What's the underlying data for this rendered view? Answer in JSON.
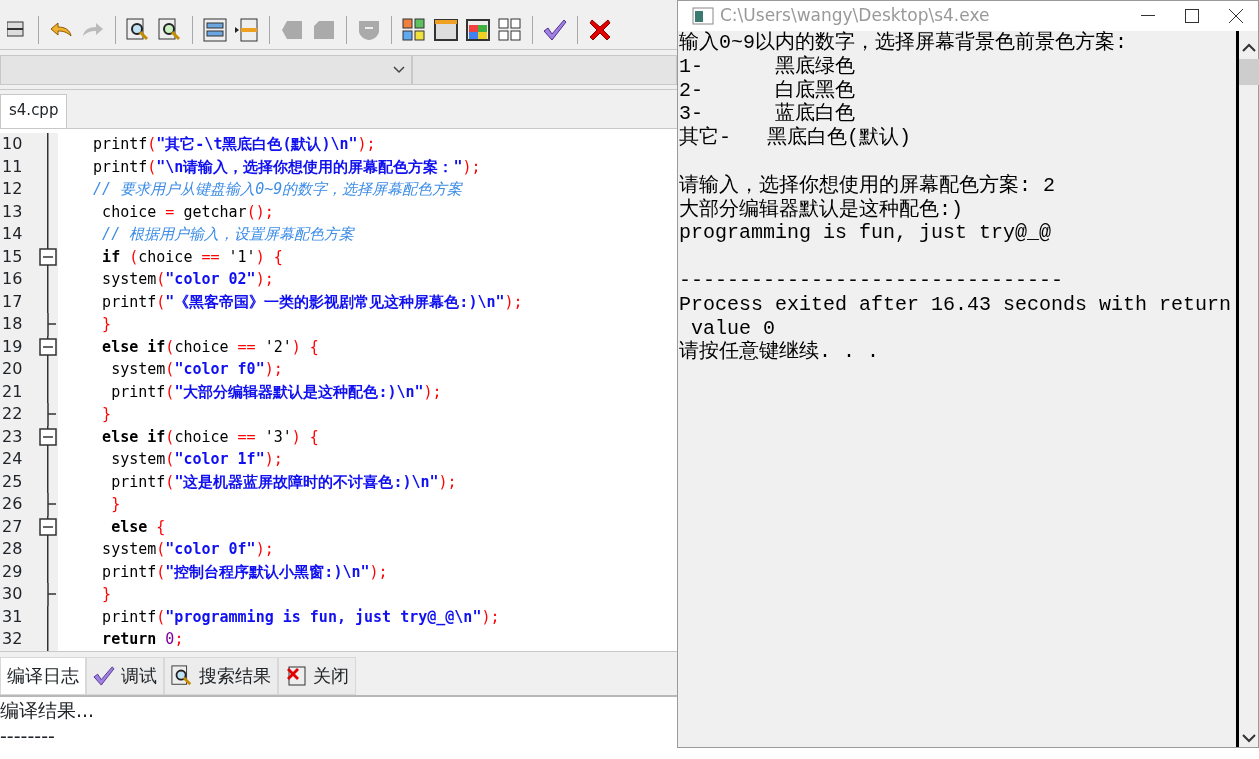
{
  "editor": {
    "tabs": [
      {
        "label": "s4.cpp",
        "selected": true
      }
    ],
    "lines": [
      {
        "n": "10",
        "kind": "line",
        "tokens": [
          {
            "text": "   printf",
            "kind": "plain"
          },
          {
            "text": "(",
            "kind": "op"
          },
          {
            "text": "\"其它-\\t黑底白色(默认)\\n\"",
            "kind": "str"
          },
          {
            "text": ");",
            "kind": "op"
          }
        ]
      },
      {
        "n": "11",
        "kind": "line",
        "tokens": [
          {
            "text": "   printf",
            "kind": "plain"
          },
          {
            "text": "(",
            "kind": "op"
          },
          {
            "text": "\"\\n请输入，选择你想使用的屏幕配色方案：\"",
            "kind": "str"
          },
          {
            "text": ");",
            "kind": "op"
          }
        ]
      },
      {
        "n": "12",
        "kind": "line",
        "tokens": [
          {
            "text": "   // 要求用户从键盘输入0~9的数字，选择屏幕配色方案",
            "kind": "cmt"
          }
        ]
      },
      {
        "n": "13",
        "kind": "line",
        "tokens": [
          {
            "text": "    choice ",
            "kind": "plain"
          },
          {
            "text": "=",
            "kind": "op"
          },
          {
            "text": " getchar",
            "kind": "plain"
          },
          {
            "text": "();",
            "kind": "op"
          }
        ]
      },
      {
        "n": "14",
        "kind": "line",
        "tokens": [
          {
            "text": "    // 根据用户输入，设置屏幕配色方案",
            "kind": "cmt"
          }
        ]
      },
      {
        "n": "15",
        "kind": "open",
        "tokens": [
          {
            "text": "    if ",
            "kind": "kw"
          },
          {
            "text": "(",
            "kind": "op"
          },
          {
            "text": "choice ",
            "kind": "plain"
          },
          {
            "text": "==",
            "kind": "op"
          },
          {
            "text": " '1'",
            "kind": "plain"
          },
          {
            "text": ") {",
            "kind": "op"
          }
        ]
      },
      {
        "n": "16",
        "kind": "line",
        "tokens": [
          {
            "text": "    system",
            "kind": "plain"
          },
          {
            "text": "(",
            "kind": "op"
          },
          {
            "text": "\"color 02\"",
            "kind": "str"
          },
          {
            "text": ");",
            "kind": "op"
          }
        ]
      },
      {
        "n": "17",
        "kind": "line",
        "tokens": [
          {
            "text": "    printf",
            "kind": "plain"
          },
          {
            "text": "(",
            "kind": "op"
          },
          {
            "text": "\"《黑客帝国》一类的影视剧常见这种屏幕色:)\\n\"",
            "kind": "str"
          },
          {
            "text": ");",
            "kind": "op"
          }
        ]
      },
      {
        "n": "18",
        "kind": "end",
        "tokens": [
          {
            "text": "    }",
            "kind": "op"
          }
        ]
      },
      {
        "n": "19",
        "kind": "open",
        "tokens": [
          {
            "text": "    else if",
            "kind": "kw"
          },
          {
            "text": "(",
            "kind": "op"
          },
          {
            "text": "choice ",
            "kind": "plain"
          },
          {
            "text": "==",
            "kind": "op"
          },
          {
            "text": " '2'",
            "kind": "plain"
          },
          {
            "text": ") {",
            "kind": "op"
          }
        ]
      },
      {
        "n": "20",
        "kind": "line",
        "tokens": [
          {
            "text": "     system",
            "kind": "plain"
          },
          {
            "text": "(",
            "kind": "op"
          },
          {
            "text": "\"color f0\"",
            "kind": "str"
          },
          {
            "text": ");",
            "kind": "op"
          }
        ]
      },
      {
        "n": "21",
        "kind": "line",
        "tokens": [
          {
            "text": "     printf",
            "kind": "plain"
          },
          {
            "text": "(",
            "kind": "op"
          },
          {
            "text": "\"大部分编辑器默认是这种配色:)\\n\"",
            "kind": "str"
          },
          {
            "text": ");",
            "kind": "op"
          }
        ]
      },
      {
        "n": "22",
        "kind": "end",
        "tokens": [
          {
            "text": "    }",
            "kind": "op"
          }
        ]
      },
      {
        "n": "23",
        "kind": "open",
        "tokens": [
          {
            "text": "    else if",
            "kind": "kw"
          },
          {
            "text": "(",
            "kind": "op"
          },
          {
            "text": "choice ",
            "kind": "plain"
          },
          {
            "text": "==",
            "kind": "op"
          },
          {
            "text": " '3'",
            "kind": "plain"
          },
          {
            "text": ") {",
            "kind": "op"
          }
        ]
      },
      {
        "n": "24",
        "kind": "line",
        "tokens": [
          {
            "text": "     system",
            "kind": "plain"
          },
          {
            "text": "(",
            "kind": "op"
          },
          {
            "text": "\"color 1f\"",
            "kind": "str"
          },
          {
            "text": ");",
            "kind": "op"
          }
        ]
      },
      {
        "n": "25",
        "kind": "line",
        "tokens": [
          {
            "text": "     printf",
            "kind": "plain"
          },
          {
            "text": "(",
            "kind": "op"
          },
          {
            "text": "\"这是机器蓝屏故障时的不讨喜色:)\\n\"",
            "kind": "str"
          },
          {
            "text": ");",
            "kind": "op"
          }
        ]
      },
      {
        "n": "26",
        "kind": "end",
        "tokens": [
          {
            "text": "     }",
            "kind": "op"
          }
        ]
      },
      {
        "n": "27",
        "kind": "open",
        "tokens": [
          {
            "text": "     else",
            "kind": "kw"
          },
          {
            "text": " {",
            "kind": "op"
          }
        ]
      },
      {
        "n": "28",
        "kind": "line",
        "tokens": [
          {
            "text": "    system",
            "kind": "plain"
          },
          {
            "text": "(",
            "kind": "op"
          },
          {
            "text": "\"color 0f\"",
            "kind": "str"
          },
          {
            "text": ");",
            "kind": "op"
          }
        ]
      },
      {
        "n": "29",
        "kind": "line",
        "tokens": [
          {
            "text": "    printf",
            "kind": "plain"
          },
          {
            "text": "(",
            "kind": "op"
          },
          {
            "text": "\"控制台程序默认小黑窗:)\\n\"",
            "kind": "str"
          },
          {
            "text": ");",
            "kind": "op"
          }
        ]
      },
      {
        "n": "30",
        "kind": "end",
        "tokens": [
          {
            "text": "    }",
            "kind": "op"
          }
        ]
      },
      {
        "n": "31",
        "kind": "line",
        "tokens": [
          {
            "text": "    printf",
            "kind": "plain"
          },
          {
            "text": "(",
            "kind": "op"
          },
          {
            "text": "\"programming is fun, just try@_@\\n\"",
            "kind": "str"
          },
          {
            "text": ");",
            "kind": "op"
          }
        ]
      },
      {
        "n": "32",
        "kind": "line",
        "tokens": [
          {
            "text": "    return ",
            "kind": "kw"
          },
          {
            "text": "0",
            "kind": "num"
          },
          {
            "text": ";",
            "kind": "op"
          }
        ]
      }
    ]
  },
  "bottom_panel": {
    "tabs": [
      {
        "label": "编译日志",
        "kind": "log",
        "selected": true
      },
      {
        "label": "调试",
        "kind": "debug",
        "selected": false
      },
      {
        "label": "搜索结果",
        "kind": "search",
        "selected": false
      },
      {
        "label": "关闭",
        "kind": "close",
        "selected": false
      }
    ],
    "log": [
      "编译结果...",
      "--------"
    ]
  },
  "console": {
    "title": "C:\\Users\\wangy\\Desktop\\s4.exe",
    "blocks": [
      [
        "输入0~9以内的数字，选择屏幕背景色前景色方案:",
        "1-      黑底绿色",
        "2-      白底黑色",
        "3-      蓝底白色",
        "其它-   黑底白色(默认)"
      ],
      [
        "请输入，选择你想使用的屏幕配色方案: 2",
        "大部分编辑器默认是这种配色:)",
        "programming is fun, just try@_@"
      ],
      [
        "--------------------------------",
        "Process exited after 16.43 seconds with return",
        " value 0",
        "请按任意键继续. . ."
      ]
    ]
  }
}
